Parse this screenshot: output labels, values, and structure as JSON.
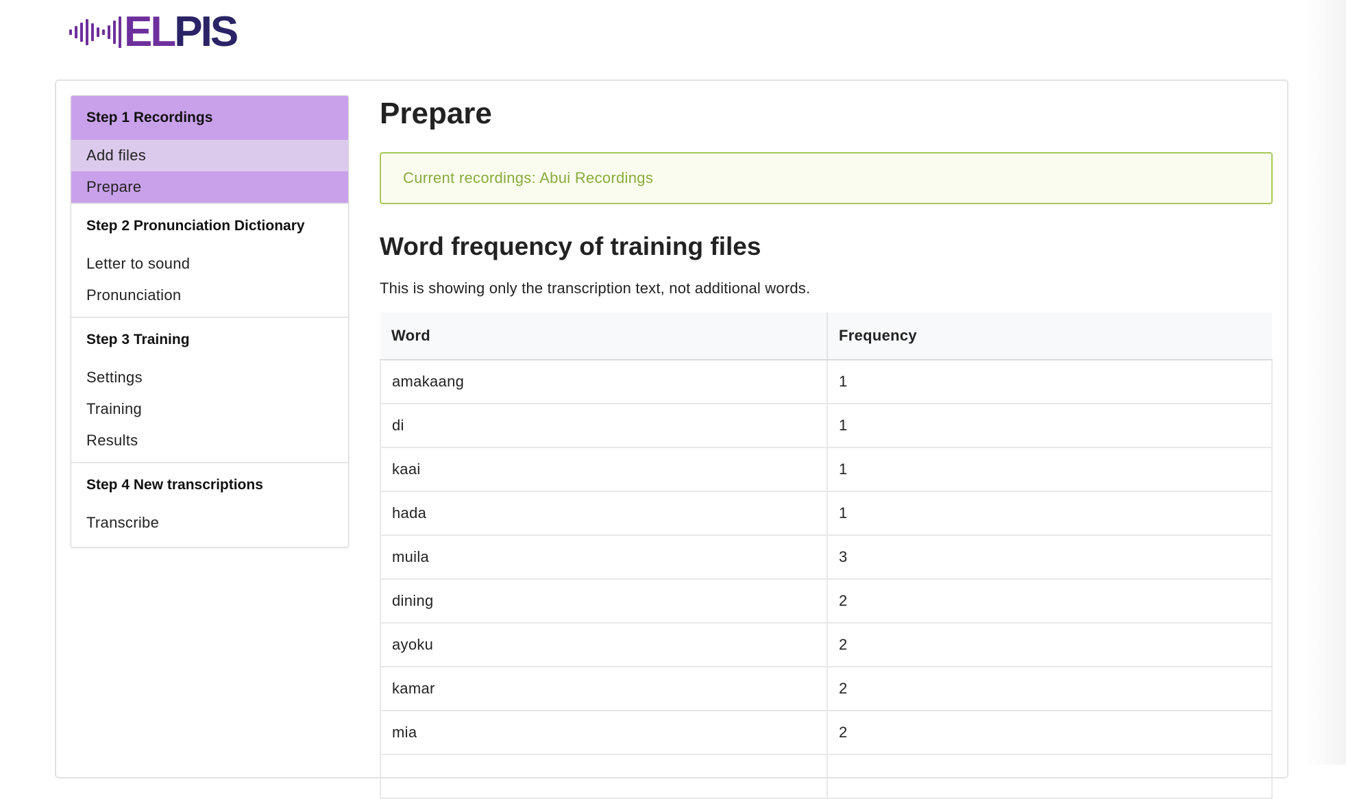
{
  "logo": {
    "text_el": "EL",
    "text_pis": "PIS",
    "colors": {
      "primary": "#6d2f9c",
      "dark": "#2a2466"
    }
  },
  "sidebar": {
    "steps": [
      {
        "title": "Step 1 Recordings",
        "items": [
          "Add files",
          "Prepare"
        ]
      },
      {
        "title": "Step 2 Pronunciation Dictionary",
        "items": [
          "Letter to sound",
          "Pronunciation"
        ]
      },
      {
        "title": "Step 3 Training",
        "items": [
          "Settings",
          "Training",
          "Results"
        ]
      },
      {
        "title": "Step 4 New transcriptions",
        "items": [
          "Transcribe"
        ]
      }
    ],
    "active_color": "#c9a1eb"
  },
  "main": {
    "title": "Prepare",
    "notice": "Current recordings: Abui Recordings",
    "section_title": "Word frequency of training files",
    "section_desc": "This is showing only the transcription text, not additional words.",
    "table": {
      "headers": [
        "Word",
        "Frequency"
      ],
      "rows": [
        [
          "amakaang",
          "1"
        ],
        [
          "di",
          "1"
        ],
        [
          "kaai",
          "1"
        ],
        [
          "hada",
          "1"
        ],
        [
          "muila",
          "3"
        ],
        [
          "dining",
          "2"
        ],
        [
          "ayoku",
          "2"
        ],
        [
          "kamar",
          "2"
        ],
        [
          "mia",
          "2"
        ],
        [
          "",
          ""
        ]
      ]
    }
  }
}
